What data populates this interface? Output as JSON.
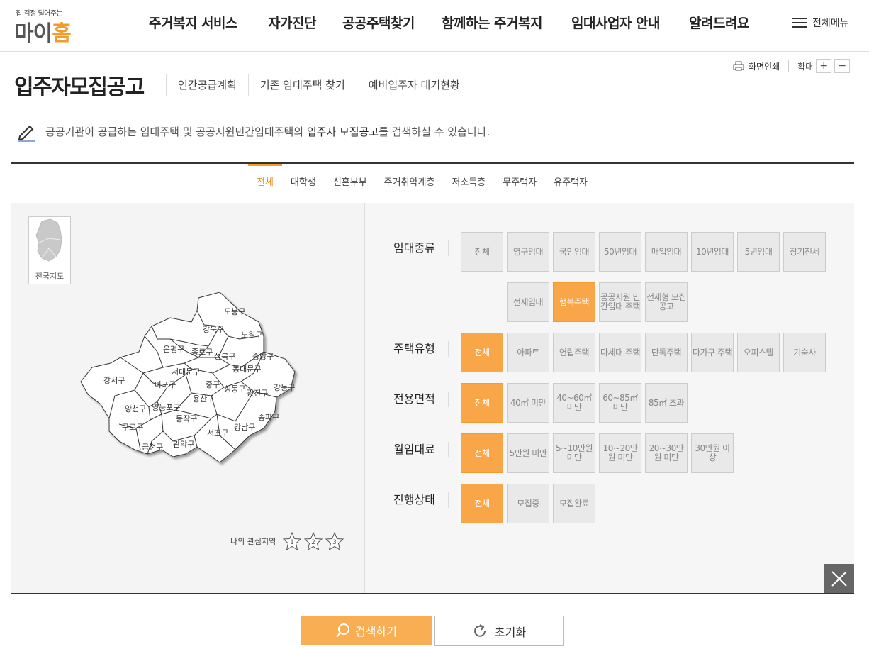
{
  "logo": {
    "tagline": "집 걱정 덜어주는",
    "name_part1": "마이",
    "name_part2": "홈"
  },
  "gnb": {
    "items": [
      "주거복지 서비스",
      "자가진단",
      "공공주택찾기",
      "함께하는 주거복지",
      "임대사업자 안내",
      "알려드려요"
    ],
    "all_menu": "전체메뉴"
  },
  "util": {
    "print": "화면인쇄",
    "zoom": "확대",
    "zoom_in": "+",
    "zoom_out": "−"
  },
  "page": {
    "title": "입주자모집공고",
    "subnav": [
      "연간공급계획",
      "기존 임대주택 찾기",
      "예비입주자 대기현황"
    ],
    "desc_prefix": "공공기관이 공급하는 임대주택 및 공공지원민간임대주택의 ",
    "desc_bold": "입주자 모집공고",
    "desc_suffix": "를 검색하실 수 있습니다."
  },
  "tabs": [
    "전체",
    "대학생",
    "신혼부부",
    "주거취약계층",
    "저소득층",
    "무주택자",
    "유주택자"
  ],
  "active_tab": "전체",
  "map": {
    "nation_label": "전국지도",
    "districts": [
      "도봉구",
      "강북구",
      "노원구",
      "은평구",
      "종로구",
      "성북구",
      "중랑구",
      "동대문구",
      "서대문구",
      "강서구",
      "마포구",
      "중구",
      "성동구",
      "광진구",
      "강동구",
      "용산구",
      "양천구",
      "영등포구",
      "동작구",
      "송파구",
      "구로구",
      "서초구",
      "강남구",
      "금천구",
      "관악구"
    ],
    "favorites_label": "나의 관심지역",
    "favorite_slots": [
      "1",
      "2",
      "3"
    ]
  },
  "filters": [
    {
      "label": "임대종류",
      "options": [
        "전체",
        "영구임대",
        "국민임대",
        "50년임대",
        "매입임대",
        "10년임대",
        "5년임대",
        "장기전세",
        "전세임대",
        "행복주택",
        "공공지원 민간임대 주택",
        "전세형 모집공고"
      ],
      "selected": "행복주택"
    },
    {
      "label": "주택유형",
      "options": [
        "전체",
        "아파트",
        "연립주택",
        "다세대 주택",
        "단독주택",
        "다가구 주택",
        "오피스텔",
        "기숙사"
      ],
      "selected": "전체"
    },
    {
      "label": "전용면적",
      "options": [
        "전체",
        "40㎡ 미만",
        "40~60㎡ 미만",
        "60~85㎡ 미만",
        "85㎡ 초과"
      ],
      "selected": "전체"
    },
    {
      "label": "월임대료",
      "options": [
        "전체",
        "5만원 미만",
        "5~10만원 미만",
        "10~20만원 미만",
        "20~30만원 미만",
        "30만원 이상"
      ],
      "selected": "전체"
    },
    {
      "label": "진행상태",
      "options": [
        "전체",
        "모집중",
        "모집완료"
      ],
      "selected": "전체"
    }
  ],
  "buttons": {
    "search": "검색하기",
    "reset": "초기화"
  },
  "colors": {
    "accent": "#f39b2c",
    "accent_light": "#f9a649"
  }
}
